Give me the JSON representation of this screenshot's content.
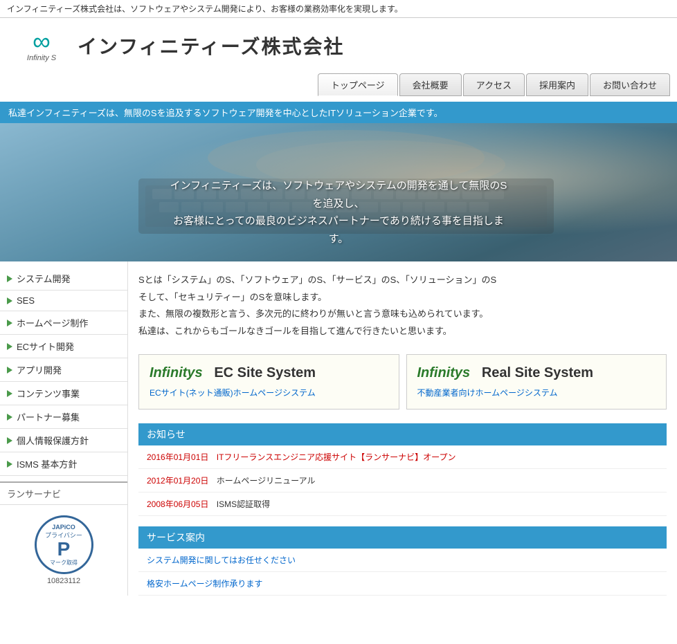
{
  "top_banner": {
    "text": "インフィニティーズ株式会社は、ソフトウェアやシステム開発により、お客様の業務効率化を実現します。"
  },
  "header": {
    "logo_symbol": "∞",
    "logo_sub": "Infinity S",
    "company_name": "インフィニティーズ株式会社"
  },
  "nav": {
    "items": [
      {
        "label": "トップページ",
        "active": true
      },
      {
        "label": "会社概要",
        "active": false
      },
      {
        "label": "アクセス",
        "active": false
      },
      {
        "label": "採用案内",
        "active": false
      },
      {
        "label": "お問い合わせ",
        "active": false
      }
    ]
  },
  "tagline": "私達インフィニティーズは、無限のSを追及するソフトウェア開発を中心としたITソリューション企業です。",
  "hero": {
    "line1": "インフィニティーズは、ソフトウェアやシステムの開発を通して無限のSを追及し、",
    "line2": "お客様にとっての最良のビジネスパートナーであり続ける事を目指します。"
  },
  "sidebar": {
    "items": [
      {
        "label": "システム開発"
      },
      {
        "label": "SES"
      },
      {
        "label": "ホームページ制作"
      },
      {
        "label": "ECサイト開発"
      },
      {
        "label": "アプリ開発"
      },
      {
        "label": "コンテンツ事業"
      },
      {
        "label": "パートナー募集"
      },
      {
        "label": "個人情報保護方針"
      },
      {
        "label": "ISMS 基本方針"
      }
    ],
    "ranser_label": "ランサーナビ",
    "privacy_label": "プライバシー",
    "privacy_num": "10823112"
  },
  "description": {
    "line1": "Sとは「システム」のS、「ソフトウェア」のS、「サービス」のS、「ソリューション」のS",
    "line2": "そして、「セキュリティー」のSを意味します。",
    "line3": "また、無限の複数形と言う、多次元的に終わりが無いと言う意味も込められています。",
    "line4": "私達は、これからもゴールなきゴールを目指して進んで行きたいと思います。"
  },
  "cards": [
    {
      "brand": "Infinitys",
      "title": "EC Site System",
      "link_text": "ECサイト(ネット通販)ホームページシステム"
    },
    {
      "brand": "Infinitys",
      "title": "Real Site System",
      "link_text": "不動産業者向けホームページシステム"
    }
  ],
  "news": {
    "header": "お知らせ",
    "items": [
      {
        "date": "2016年01月01日",
        "text": "ITフリーランスエンジニア応援サイト【ランサーナビ】オープン",
        "is_link": true
      },
      {
        "date": "2012年01月20日",
        "text": "ホームページリニューアル",
        "is_link": false
      },
      {
        "date": "2008年06月05日",
        "text": "ISMS認証取得",
        "is_link": false
      }
    ]
  },
  "services": {
    "header": "サービス案内",
    "items": [
      {
        "text": "システム開発に関してはお任せください"
      },
      {
        "text": "格安ホームページ制作承ります"
      }
    ]
  }
}
